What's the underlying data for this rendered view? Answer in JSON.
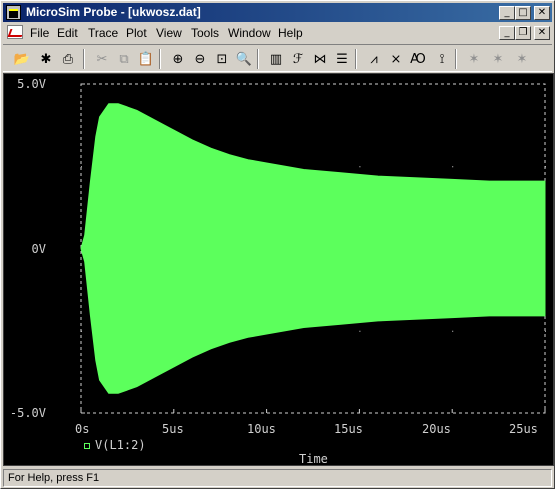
{
  "window": {
    "title": "MicroSim Probe - [ukwosz.dat]",
    "controls": {
      "minimize": "_",
      "maximize": "□",
      "close": "✕"
    }
  },
  "menubar": {
    "items": [
      "File",
      "Edit",
      "Trace",
      "Plot",
      "View",
      "Tools",
      "Window",
      "Help"
    ],
    "doc_controls": {
      "minimize": "_",
      "restore": "❐",
      "close": "✕"
    }
  },
  "toolbar": {
    "icons": [
      {
        "name": "open-icon",
        "glyph": "📂",
        "enabled": true
      },
      {
        "name": "new-icon",
        "glyph": "✱",
        "enabled": true
      },
      {
        "name": "print-icon",
        "glyph": "⎙",
        "enabled": true
      },
      {
        "name": "cut-icon",
        "glyph": "✂",
        "enabled": false
      },
      {
        "name": "copy-icon",
        "glyph": "⧉",
        "enabled": false
      },
      {
        "name": "paste-icon",
        "glyph": "📋",
        "enabled": false
      },
      {
        "name": "zoom-in-icon",
        "glyph": "⊕",
        "enabled": true
      },
      {
        "name": "zoom-out-icon",
        "glyph": "⊖",
        "enabled": true
      },
      {
        "name": "zoom-area-icon",
        "glyph": "⊡",
        "enabled": true
      },
      {
        "name": "zoom-fit-icon",
        "glyph": "🔍",
        "enabled": true
      },
      {
        "name": "log-x-icon",
        "glyph": "▥",
        "enabled": true
      },
      {
        "name": "fft-icon",
        "glyph": "ℱ",
        "enabled": true
      },
      {
        "name": "performance-icon",
        "glyph": "⋈",
        "enabled": true
      },
      {
        "name": "eval-goal-icon",
        "glyph": "☰",
        "enabled": true
      },
      {
        "name": "add-trace-icon",
        "glyph": "⩘",
        "enabled": true
      },
      {
        "name": "remove-trace-icon",
        "glyph": "⨯",
        "enabled": true
      },
      {
        "name": "label-text-icon",
        "glyph": "Ꜵ",
        "enabled": true
      },
      {
        "name": "mark-icon",
        "glyph": "⟟",
        "enabled": true
      },
      {
        "name": "cursor-peak-icon",
        "glyph": "✶",
        "enabled": false
      },
      {
        "name": "cursor-trough-icon",
        "glyph": "✶",
        "enabled": false
      },
      {
        "name": "cursor-slope-icon",
        "glyph": "✶",
        "enabled": false
      },
      {
        "name": "cursor-min-icon",
        "glyph": "✶",
        "enabled": false
      },
      {
        "name": "cursor-max-icon",
        "glyph": "✶",
        "enabled": false
      }
    ]
  },
  "plot": {
    "y_ticks": [
      "5.0V",
      "0V",
      "-5.0V"
    ],
    "x_ticks": [
      "0s",
      "5us",
      "10us",
      "15us",
      "20us",
      "25us"
    ],
    "legend": "V(L1:2)",
    "x_title": "Time",
    "trace_color": "#5cff5c",
    "background": "#000000",
    "axis_color": "#d0d0d0"
  },
  "chart_data": {
    "type": "area",
    "series": [
      {
        "name": "V(L1:2)"
      }
    ],
    "xlabel": "Time",
    "x_unit": "us",
    "xlim": [
      0,
      25
    ],
    "ylim": [
      -5.0,
      5.0
    ],
    "envelope": {
      "x": [
        0,
        0.2,
        0.5,
        0.8,
        1.0,
        1.5,
        2.0,
        3.0,
        4.0,
        5.0,
        6.0,
        7.0,
        8.0,
        9.0,
        10.0,
        11.0,
        12.0,
        14.0,
        16.0,
        18.0,
        20.0,
        22.0,
        25.0
      ],
      "upper": [
        0.0,
        0.4,
        2.0,
        3.4,
        4.0,
        4.4,
        4.4,
        4.2,
        3.9,
        3.6,
        3.3,
        3.05,
        2.85,
        2.7,
        2.6,
        2.5,
        2.4,
        2.3,
        2.2,
        2.15,
        2.1,
        2.05,
        2.05
      ],
      "lower": [
        0.0,
        -0.4,
        -2.0,
        -3.4,
        -4.0,
        -4.4,
        -4.4,
        -4.2,
        -3.9,
        -3.6,
        -3.3,
        -3.05,
        -2.85,
        -2.7,
        -2.6,
        -2.5,
        -2.4,
        -2.3,
        -2.2,
        -2.15,
        -2.1,
        -2.05,
        -2.05
      ]
    },
    "grid": "dotted"
  },
  "statusbar": {
    "text": "For Help, press F1"
  }
}
